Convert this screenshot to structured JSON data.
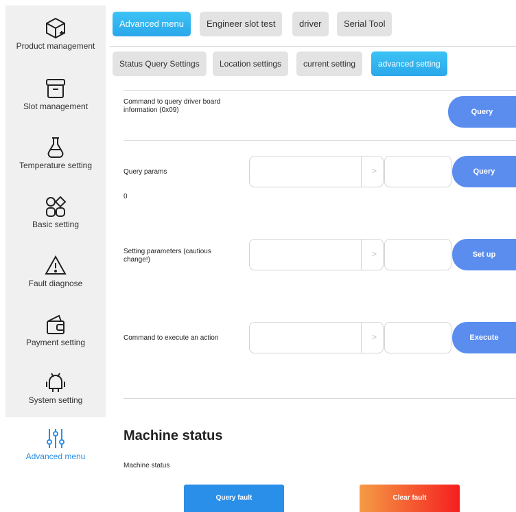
{
  "sidebar": {
    "items": [
      {
        "label": "Product management",
        "icon": "product-cube-icon"
      },
      {
        "label": "Slot management",
        "icon": "slot-box-icon"
      },
      {
        "label": "Temperature setting",
        "icon": "flask-icon"
      },
      {
        "label": "Basic setting",
        "icon": "grid-shapes-icon"
      },
      {
        "label": "Fault diagnose",
        "icon": "warning-icon"
      },
      {
        "label": "Payment setting",
        "icon": "wallet-icon"
      },
      {
        "label": "System setting",
        "icon": "android-icon"
      }
    ],
    "active": {
      "label": "Advanced menu",
      "icon": "sliders-icon"
    }
  },
  "top_tabs": [
    "Advanced menu",
    "Engineer slot test",
    "driver",
    "Serial Tool"
  ],
  "sub_tabs": [
    "Status Query Settings",
    "Location settings",
    "current setting",
    "advanced setting"
  ],
  "rows": {
    "query_info": {
      "label": "Command to query driver board information (0x09)",
      "button": "Query"
    },
    "query_params": {
      "label": "Query params",
      "button": "Query",
      "result": "0",
      "value_a": "",
      "value_b": ""
    },
    "setting_params": {
      "label": "Setting parameters (cautious change!)",
      "button": "Set up",
      "value_a": "",
      "value_b": ""
    },
    "execute": {
      "label": "Command to execute an action",
      "button": "Execute",
      "value_a": "",
      "value_b": ""
    }
  },
  "machine": {
    "title": "Machine status",
    "label": "Machine status",
    "query_fault": "Query fault",
    "clear_fault": "Clear fault"
  },
  "colors": {
    "accent": "#2aa7ea",
    "button_blue": "#5b8def",
    "active_text": "#2a8fe8",
    "clear_start": "#f59b45",
    "clear_end": "#f51f1f",
    "query_fault": "#2a8fe8"
  }
}
